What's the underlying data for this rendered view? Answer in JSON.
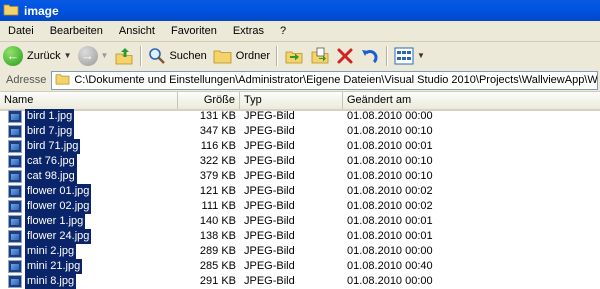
{
  "window": {
    "title": "image"
  },
  "menu": [
    "Datei",
    "Bearbeiten",
    "Ansicht",
    "Favoriten",
    "Extras",
    "?"
  ],
  "toolbar": {
    "back": "Zurück",
    "search": "Suchen",
    "folders": "Ordner"
  },
  "address": {
    "label": "Adresse",
    "value": "C:\\Dokumente und Einstellungen\\Administrator\\Eigene Dateien\\Visual Studio 2010\\Projects\\WallviewApp\\WallviewApp.Web\\image"
  },
  "columns": {
    "name": "Name",
    "size": "Größe",
    "type": "Typ",
    "date": "Geändert am"
  },
  "files": [
    {
      "name": "bird 1.jpg",
      "size": "131 KB",
      "type": "JPEG-Bild",
      "date": "01.08.2010 00:00"
    },
    {
      "name": "bird 7.jpg",
      "size": "347 KB",
      "type": "JPEG-Bild",
      "date": "01.08.2010 00:10"
    },
    {
      "name": "bird 71.jpg",
      "size": "116 KB",
      "type": "JPEG-Bild",
      "date": "01.08.2010 00:01"
    },
    {
      "name": "cat 76.jpg",
      "size": "322 KB",
      "type": "JPEG-Bild",
      "date": "01.08.2010 00:10"
    },
    {
      "name": "cat 98.jpg",
      "size": "379 KB",
      "type": "JPEG-Bild",
      "date": "01.08.2010 00:10"
    },
    {
      "name": "flower 01.jpg",
      "size": "121 KB",
      "type": "JPEG-Bild",
      "date": "01.08.2010 00:02"
    },
    {
      "name": "flower 02.jpg",
      "size": "111 KB",
      "type": "JPEG-Bild",
      "date": "01.08.2010 00:02"
    },
    {
      "name": "flower 1.jpg",
      "size": "140 KB",
      "type": "JPEG-Bild",
      "date": "01.08.2010 00:01"
    },
    {
      "name": "flower 24.jpg",
      "size": "138 KB",
      "type": "JPEG-Bild",
      "date": "01.08.2010 00:01"
    },
    {
      "name": "mini 2.jpg",
      "size": "289 KB",
      "type": "JPEG-Bild",
      "date": "01.08.2010 00:00"
    },
    {
      "name": "mini 21.jpg",
      "size": "285 KB",
      "type": "JPEG-Bild",
      "date": "01.08.2010 00:40"
    },
    {
      "name": "mini 8.jpg",
      "size": "291 KB",
      "type": "JPEG-Bild",
      "date": "01.08.2010 00:00"
    }
  ],
  "colors": {
    "selection": "#0a246a",
    "titlebar": "#0054e3",
    "chrome": "#ece9d8"
  }
}
